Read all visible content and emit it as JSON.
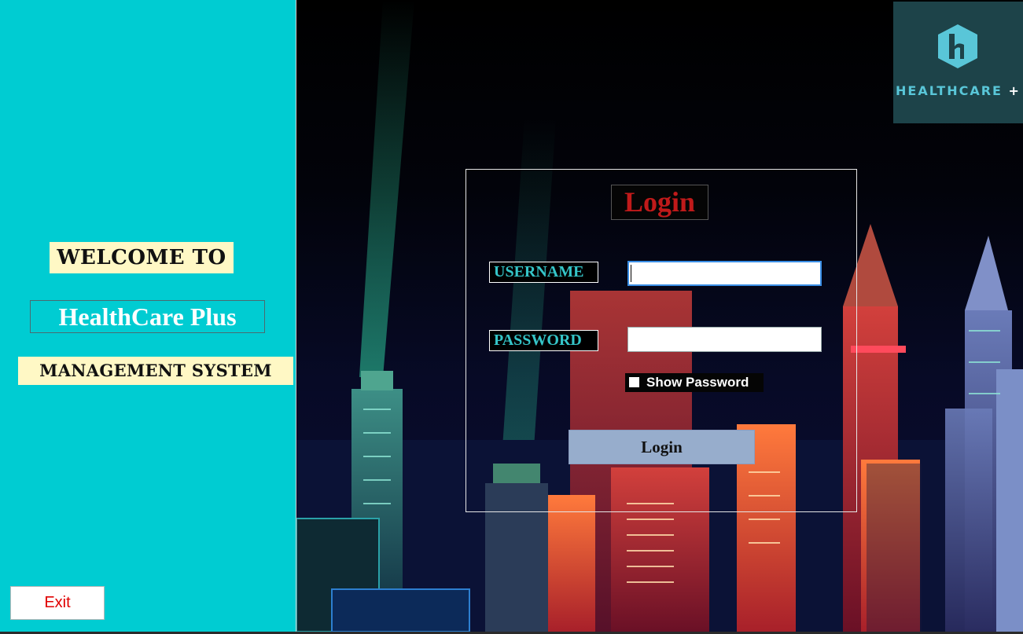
{
  "sidebar": {
    "welcome": "WELCOME TO",
    "app_name": "HealthCare Plus",
    "subtitle": "MANAGEMENT SYSTEM",
    "exit_label": "Exit"
  },
  "logo": {
    "text": "HEALTHCARE",
    "plus": "+"
  },
  "login": {
    "title": "Login",
    "username_label": "USERNAME",
    "password_label": "PASSWORD",
    "username_value": "",
    "password_value": "",
    "show_password_label": "Show Password",
    "show_password_checked": false,
    "button_label": "Login"
  },
  "colors": {
    "sidebar_bg": "#00CCD2",
    "label_highlight": "#FFF8C5",
    "login_title": "#C01A1A",
    "field_label": "#35C5C8",
    "login_button": "#97ADCC",
    "exit_text": "#E00000",
    "logo_bg": "#1D4349",
    "logo_accent": "#59C6D8"
  }
}
